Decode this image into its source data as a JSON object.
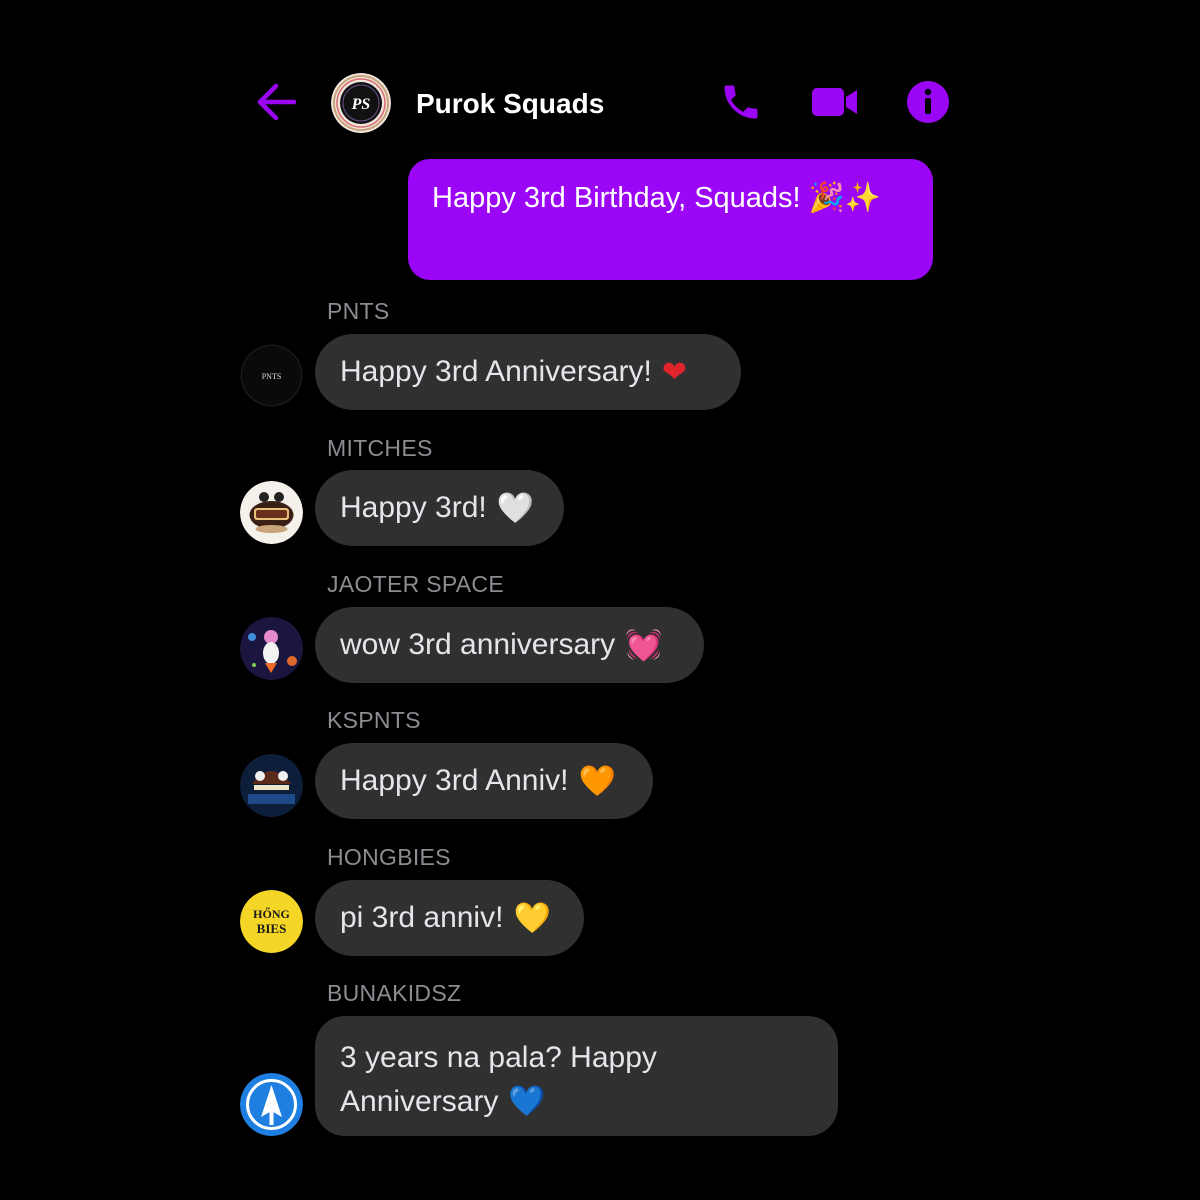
{
  "header": {
    "back_icon": "arrow-left-icon",
    "group_avatar_text": "PS",
    "title": "Purok Squads",
    "call_icon": "phone-icon",
    "video_icon": "video-camera-icon",
    "info_icon": "info-icon"
  },
  "colors": {
    "accent": "#9b06f7",
    "bubble_received": "#303030",
    "background": "#000000",
    "sender_name": "#8a8d91"
  },
  "sent_message": {
    "text": "Happy 3rd Birthday, Squads! 🎉✨"
  },
  "messages": [
    {
      "sender": "PNTS",
      "avatar_text": "PNTS",
      "text": "Happy 3rd Anniversary!",
      "emoji": "❤"
    },
    {
      "sender": "MITCHES",
      "avatar_text": "",
      "text": "Happy 3rd!",
      "emoji": "🤍"
    },
    {
      "sender": "JAOTER SPACE",
      "avatar_text": "",
      "text": "wow 3rd anniversary",
      "emoji": "💓"
    },
    {
      "sender": "KSPNTS",
      "avatar_text": "",
      "text": "Happy 3rd Anniv!",
      "emoji": "🧡"
    },
    {
      "sender": "HONGBIES",
      "avatar_text": "HONG BIES",
      "text": "pi 3rd anniv!",
      "emoji": "💛"
    },
    {
      "sender": "BUNAKIDSZ",
      "avatar_text": "",
      "text": "3 years na pala? Happy Anniversary",
      "emoji": "💙"
    }
  ]
}
